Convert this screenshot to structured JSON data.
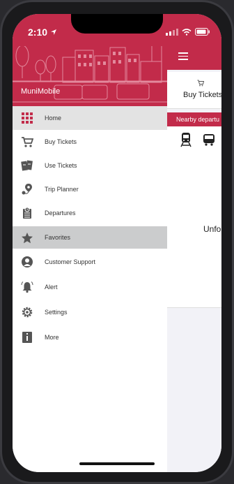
{
  "status": {
    "time": "2:10"
  },
  "drawer": {
    "app_name": "MuniMobile",
    "items": [
      {
        "label": "Home",
        "icon": "grid-icon"
      },
      {
        "label": "Buy Tickets",
        "icon": "cart-icon"
      },
      {
        "label": "Use Tickets",
        "icon": "tickets-icon"
      },
      {
        "label": "Trip Planner",
        "icon": "map-pin-icon"
      },
      {
        "label": "Departures",
        "icon": "departures-icon"
      },
      {
        "label": "Favorites",
        "icon": "star-icon"
      },
      {
        "label": "Customer Support",
        "icon": "support-icon"
      },
      {
        "label": "Alert",
        "icon": "bell-icon"
      },
      {
        "label": "Settings",
        "icon": "gear-icon"
      },
      {
        "label": "More",
        "icon": "info-icon"
      }
    ]
  },
  "content": {
    "buy_tickets_label": "Buy Tickets",
    "nearby_label": "Nearby departu",
    "truncated_text": "Unfo"
  },
  "colors": {
    "brand": "#c22b4a",
    "active_row": "#e3e3e3",
    "highlight_row": "#cbcccd"
  }
}
